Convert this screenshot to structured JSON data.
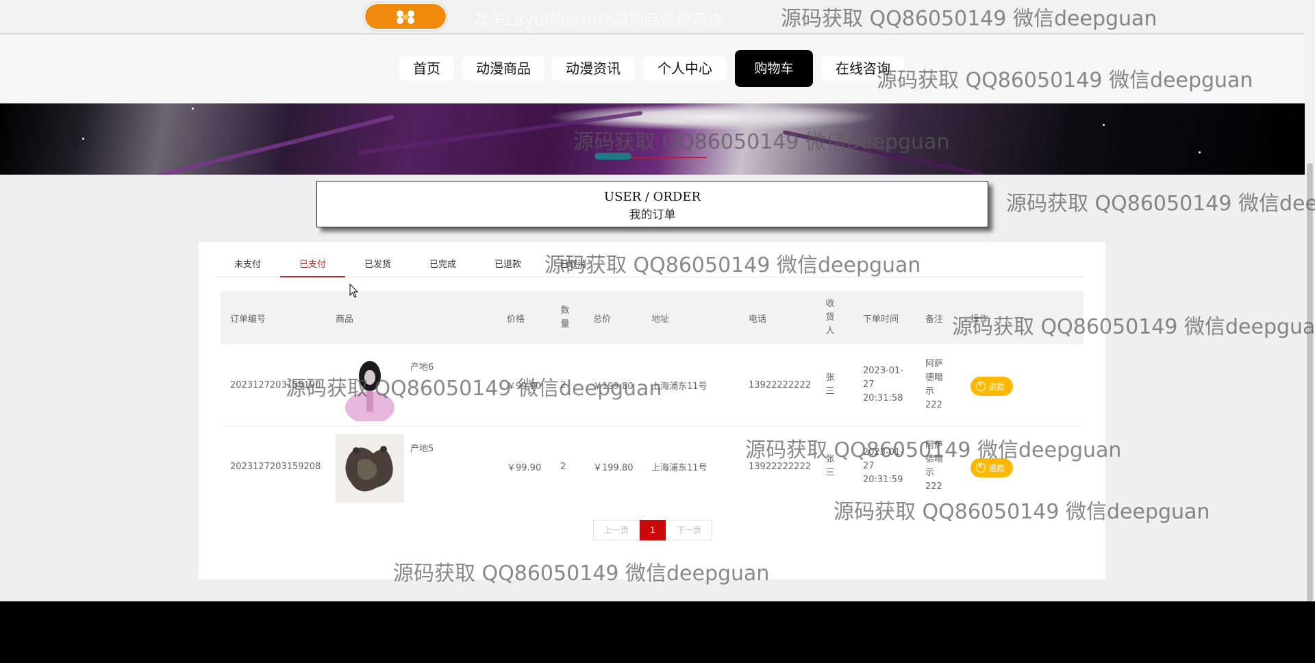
{
  "header": {
    "site_title": "基于Layui的ssm动漫商品管理系统",
    "nav": [
      "首页",
      "动漫商品",
      "动漫资讯",
      "个人中心",
      "购物车",
      "在线咨询"
    ],
    "active_nav": "购物车"
  },
  "order_card": {
    "en": "USER / ORDER",
    "cn": "我的订单"
  },
  "tabs": [
    "未支付",
    "已支付",
    "已发货",
    "已完成",
    "已退款",
    "已取消"
  ],
  "active_tab": "已支付",
  "table": {
    "headers": {
      "order_no": "订单编号",
      "product": "商品",
      "price": "价格",
      "quantity": "数量",
      "total": "总价",
      "address": "地址",
      "phone": "电话",
      "receiver": "收货人",
      "order_time": "下单时间",
      "remark": "备注",
      "action": "操作"
    },
    "rows": [
      {
        "order_no": "2023127203158190",
        "product": "产地6",
        "price": "￥99.90",
        "quantity": "2",
        "total": "￥199.80",
        "address": "上海浦东11号",
        "phone": "13922222222",
        "receiver": "张三",
        "order_time": "2023-01-27 20:31:58",
        "remark": "阿萨德暗示222",
        "action": "退款"
      },
      {
        "order_no": "2023127203159208",
        "product": "产地5",
        "price": "￥99.90",
        "quantity": "2",
        "total": "￥199.80",
        "address": "上海浦东11号",
        "phone": "13922222222",
        "receiver": "张三",
        "order_time": "2023-01-27 20:31:59",
        "remark": "阿萨德暗示222",
        "action": "退款"
      }
    ]
  },
  "pagination": {
    "prev": "上一页",
    "current": "1",
    "next": "下一页"
  },
  "watermark": "源码获取 QQ86050149 微信deepguan",
  "colors": {
    "accent": "#b0322e",
    "active_nav_bg": "#000000",
    "refund_button": "#ffb800",
    "page_current": "#c9090a",
    "logo": "#f08a0c"
  }
}
